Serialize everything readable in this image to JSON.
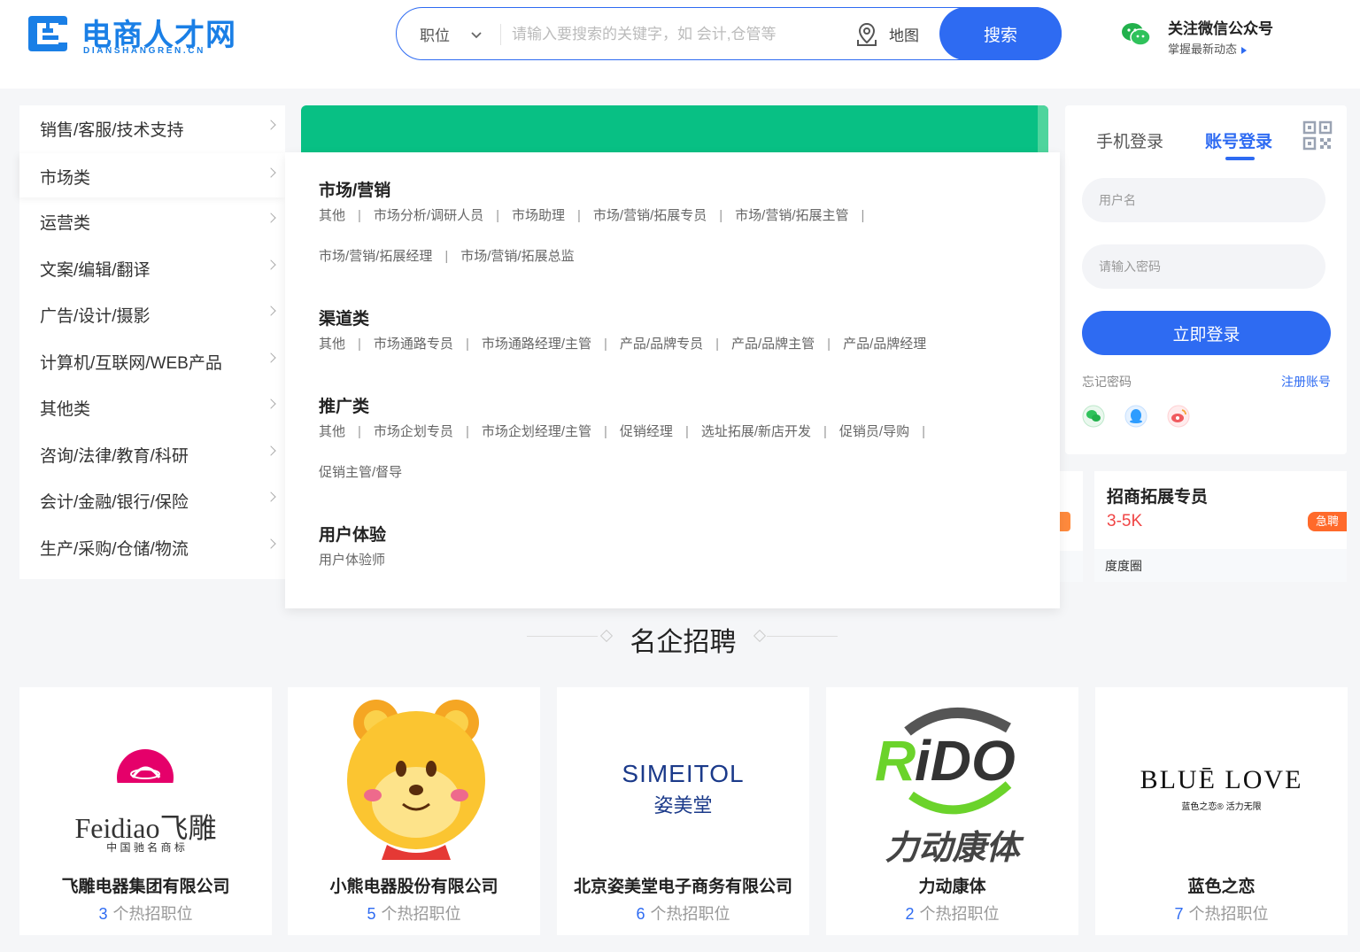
{
  "header": {
    "logo_cn": "电商人才网",
    "logo_en": "DIANSHANGREN.CN",
    "search": {
      "type_label": "职位",
      "placeholder": "请输入要搜索的关键字，如 会计,仓管等",
      "map_label": "地图",
      "button_label": "搜索"
    },
    "wechat": {
      "title": "关注微信公众号",
      "subtitle": "掌握最新动态"
    }
  },
  "categories": [
    "销售/客服/技术支持",
    "市场类",
    "运营类",
    "文案/编辑/翻译",
    "广告/设计/摄影",
    "计算机/互联网/WEB产品",
    "其他类",
    "咨询/法律/教育/科研",
    "会计/金融/银行/保险",
    "生产/采购/仓储/物流"
  ],
  "panel": {
    "groups": [
      {
        "title": "市场/营销",
        "items": [
          "其他",
          "市场分析/调研人员",
          "市场助理",
          "市场/营销/拓展专员",
          "市场/营销/拓展主管",
          "市场/营销/拓展经理",
          "市场/营销/拓展总监"
        ]
      },
      {
        "title": "渠道类",
        "items": [
          "其他",
          "市场通路专员",
          "市场通路经理/主管",
          "产品/品牌专员",
          "产品/品牌主管",
          "产品/品牌经理"
        ]
      },
      {
        "title": "推广类",
        "items": [
          "其他",
          "市场企划专员",
          "市场企划经理/主管",
          "促销经理",
          "选址拓展/新店开发",
          "促销员/导购",
          "促销主管/督导"
        ]
      },
      {
        "title": "用户体验",
        "items": [
          "用户体验师"
        ]
      }
    ]
  },
  "login": {
    "tab_phone": "手机登录",
    "tab_account": "账号登录",
    "username_placeholder": "用户名",
    "password_placeholder": "请输入密码",
    "submit_label": "立即登录",
    "forgot_label": "忘记密码",
    "register_label": "注册账号"
  },
  "job_card": {
    "title": "招商拓展专员",
    "salary": "3-5K",
    "badge": "急聘",
    "company": "度度圈"
  },
  "section_title": "名企招聘",
  "companies": [
    {
      "name": "飞雕电器集团有限公司",
      "count": "3",
      "suffix": "个热招职位",
      "logo_text": "Feidiao飞雕",
      "logo_sub": "中 国 驰 名 商 标"
    },
    {
      "name": "小熊电器股份有限公司",
      "count": "5",
      "suffix": "个热招职位"
    },
    {
      "name": "北京姿美堂电子商务有限公司",
      "count": "6",
      "suffix": "个热招职位",
      "logo_text": "SIMEITOL",
      "logo_sub": "姿美堂"
    },
    {
      "name": "力动康体",
      "count": "2",
      "suffix": "个热招职位",
      "logo_text": "RiDO",
      "logo_sub": "力动康体"
    },
    {
      "name": "蓝色之恋",
      "count": "7",
      "suffix": "个热招职位",
      "logo_text": "BLUĒ LOVE",
      "logo_sub": "蓝色之恋® 活力无限"
    }
  ],
  "colors": {
    "primary": "#2e6bf2",
    "banner": "#08c084",
    "salary": "#f04545",
    "urgent": "#ff6a2b"
  }
}
